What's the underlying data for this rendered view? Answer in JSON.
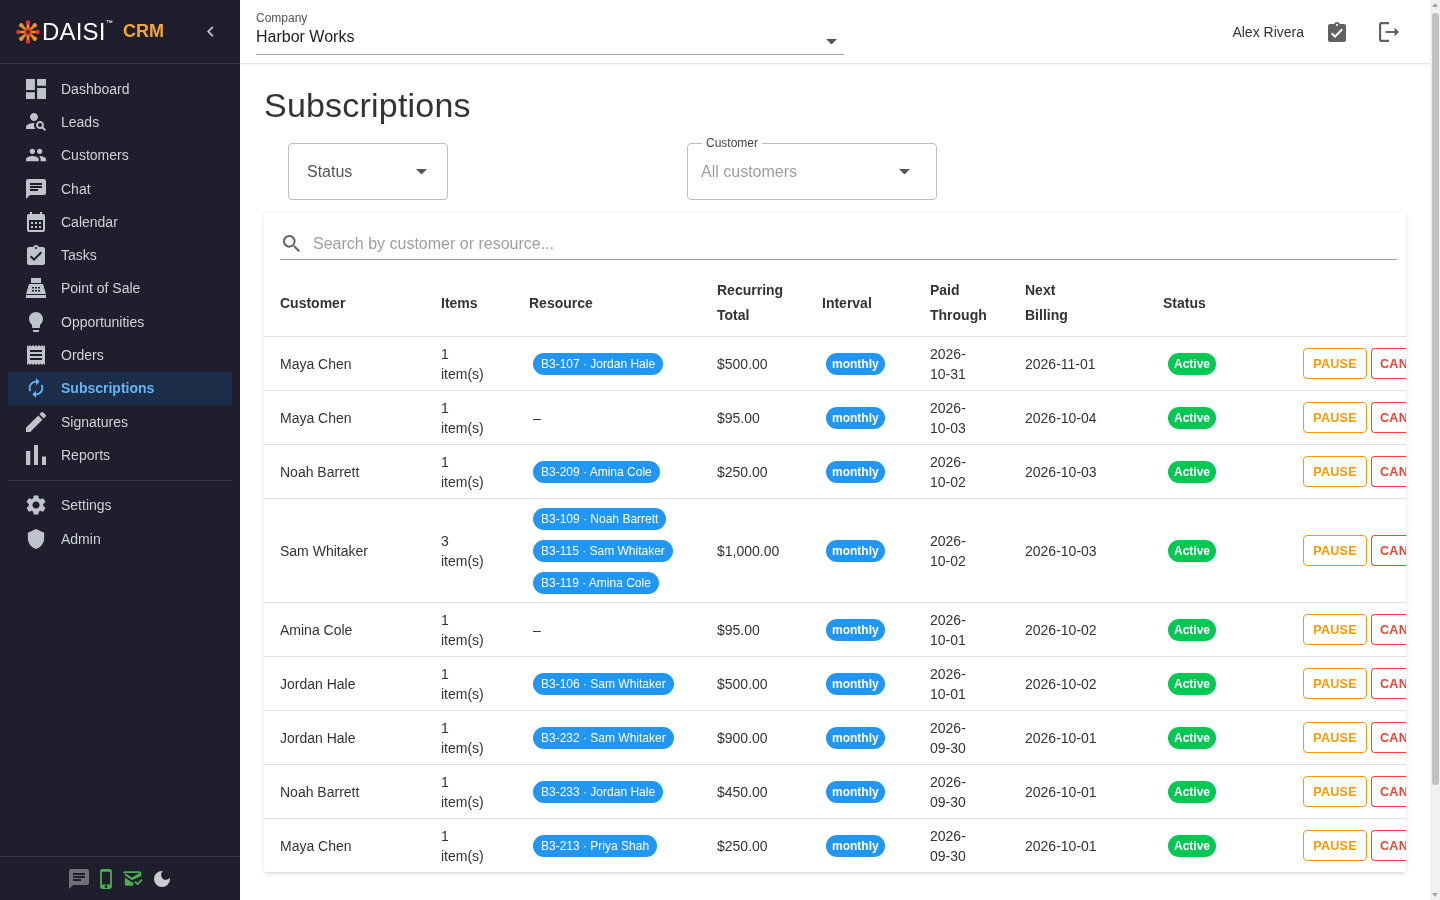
{
  "sidebar": {
    "logo": {
      "name": "DAISI$^{™}$",
      "product": "CRM"
    },
    "nav": [
      {
        "label": "Dashboard",
        "selected": false
      },
      {
        "label": "Leads",
        "selected": false
      },
      {
        "label": "Customers",
        "selected": false
      },
      {
        "label": "Chat",
        "selected": false
      },
      {
        "label": "Calendar",
        "selected": false
      },
      {
        "label": "Tasks",
        "selected": false
      },
      {
        "label": "Point of Sale",
        "selected": false
      },
      {
        "label": "Opportunities",
        "selected": false
      },
      {
        "label": "Orders",
        "selected": false
      },
      {
        "label": "Subscriptions",
        "selected": true
      },
      {
        "label": "Signatures",
        "selected": false
      },
      {
        "label": "Reports",
        "selected": false
      }
    ],
    "nav_secondary": [
      {
        "label": "Settings",
        "selected": false
      },
      {
        "label": "Admin",
        "selected": false
      }
    ],
    "footer": {
      "chat_connected": false,
      "phone_connected": true,
      "email_connected": true
    }
  },
  "header": {
    "company": {
      "label": "Company",
      "value": "Harbor Works"
    },
    "user_name": "Alex Rivera"
  },
  "page": {
    "title": "Subscriptions",
    "filters": {
      "status": {
        "label": "Status"
      },
      "customer": {
        "label": "Customer",
        "placeholder": "All customers"
      }
    },
    "search": {
      "placeholder": "Search by customer or resource..."
    }
  },
  "table": {
    "columns": [
      "Customer",
      "Items",
      "Resource",
      "Recurring Total",
      "Interval",
      "Paid Through",
      "Next Billing",
      "Status"
    ],
    "rows": [
      {
        "customer": "Maya Chen",
        "items": "1 item(s)",
        "resources": [
          {
            "kind": "chip",
            "label": "B3-107 · Jordan Hale"
          }
        ],
        "total": "$500.00",
        "interval": "monthly",
        "paid_through": "2026-10-31",
        "next_billing": "2026-11-01",
        "status": "Active",
        "actions": [
          {
            "kind": "pause",
            "label": "PAUSE"
          },
          {
            "kind": "cancel",
            "label": "CAN"
          }
        ]
      },
      {
        "customer": "Maya Chen",
        "items": "1 item(s)",
        "resources": [
          {
            "kind": "text",
            "label": "–"
          }
        ],
        "total": "$95.00",
        "interval": "monthly",
        "paid_through": "2026-10-03",
        "next_billing": "2026-10-04",
        "status": "Active",
        "actions": [
          {
            "kind": "pause",
            "label": "PAUSE"
          },
          {
            "kind": "cancel",
            "label": "CAN"
          }
        ]
      },
      {
        "customer": "Noah Barrett",
        "items": "1 item(s)",
        "resources": [
          {
            "kind": "chip",
            "label": "B3-209 · Amina Cole"
          }
        ],
        "total": "$250.00",
        "interval": "monthly",
        "paid_through": "2026-10-02",
        "next_billing": "2026-10-03",
        "status": "Active",
        "actions": [
          {
            "kind": "pause",
            "label": "PAUSE"
          },
          {
            "kind": "cancel",
            "label": "CAN"
          }
        ]
      },
      {
        "customer": "Sam Whitaker",
        "items": "3 item(s)",
        "resources": [
          {
            "kind": "chip",
            "label": "B3-109 · Noah Barrett"
          },
          {
            "kind": "chip",
            "label": "B3-115 · Sam Whitaker"
          },
          {
            "kind": "chip",
            "label": "B3-119 · Amina Cole"
          }
        ],
        "total": "$1,000.00",
        "interval": "monthly",
        "paid_through": "2026-10-02",
        "next_billing": "2026-10-03",
        "status": "Active",
        "actions": [
          {
            "kind": "pause",
            "label": "PAUSE"
          },
          {
            "kind": "cancel",
            "label": "CAN"
          }
        ]
      },
      {
        "customer": "Amina Cole",
        "items": "1 item(s)",
        "resources": [
          {
            "kind": "text",
            "label": "–"
          }
        ],
        "total": "$95.00",
        "interval": "monthly",
        "paid_through": "2026-10-01",
        "next_billing": "2026-10-02",
        "status": "Active",
        "actions": [
          {
            "kind": "pause",
            "label": "PAUSE"
          },
          {
            "kind": "cancel",
            "label": "CAN"
          }
        ]
      },
      {
        "customer": "Jordan Hale",
        "items": "1 item(s)",
        "resources": [
          {
            "kind": "chip",
            "label": "B3-106 · Sam Whitaker"
          }
        ],
        "total": "$500.00",
        "interval": "monthly",
        "paid_through": "2026-10-01",
        "next_billing": "2026-10-02",
        "status": "Active",
        "actions": [
          {
            "kind": "pause",
            "label": "PAUSE"
          },
          {
            "kind": "cancel",
            "label": "CAN"
          }
        ]
      },
      {
        "customer": "Jordan Hale",
        "items": "1 item(s)",
        "resources": [
          {
            "kind": "chip",
            "label": "B3-232 · Sam Whitaker"
          }
        ],
        "total": "$900.00",
        "interval": "monthly",
        "paid_through": "2026-09-30",
        "next_billing": "2026-10-01",
        "status": "Active",
        "actions": [
          {
            "kind": "pause",
            "label": "PAUSE"
          },
          {
            "kind": "cancel",
            "label": "CAN"
          }
        ]
      },
      {
        "customer": "Noah Barrett",
        "items": "1 item(s)",
        "resources": [
          {
            "kind": "chip",
            "label": "B3-233 · Jordan Hale"
          }
        ],
        "total": "$450.00",
        "interval": "monthly",
        "paid_through": "2026-09-30",
        "next_billing": "2026-10-01",
        "status": "Active",
        "actions": [
          {
            "kind": "pause",
            "label": "PAUSE"
          },
          {
            "kind": "cancel",
            "label": "CAN"
          }
        ]
      },
      {
        "customer": "Maya Chen",
        "items": "1 item(s)",
        "resources": [
          {
            "kind": "chip",
            "label": "B3-213 · Priya Shah"
          }
        ],
        "total": "$250.00",
        "interval": "monthly",
        "paid_through": "2026-09-30",
        "next_billing": "2026-10-01",
        "status": "Active",
        "actions": [
          {
            "kind": "pause",
            "label": "PAUSE"
          },
          {
            "kind": "cancel",
            "label": "CAN"
          }
        ]
      }
    ]
  }
}
